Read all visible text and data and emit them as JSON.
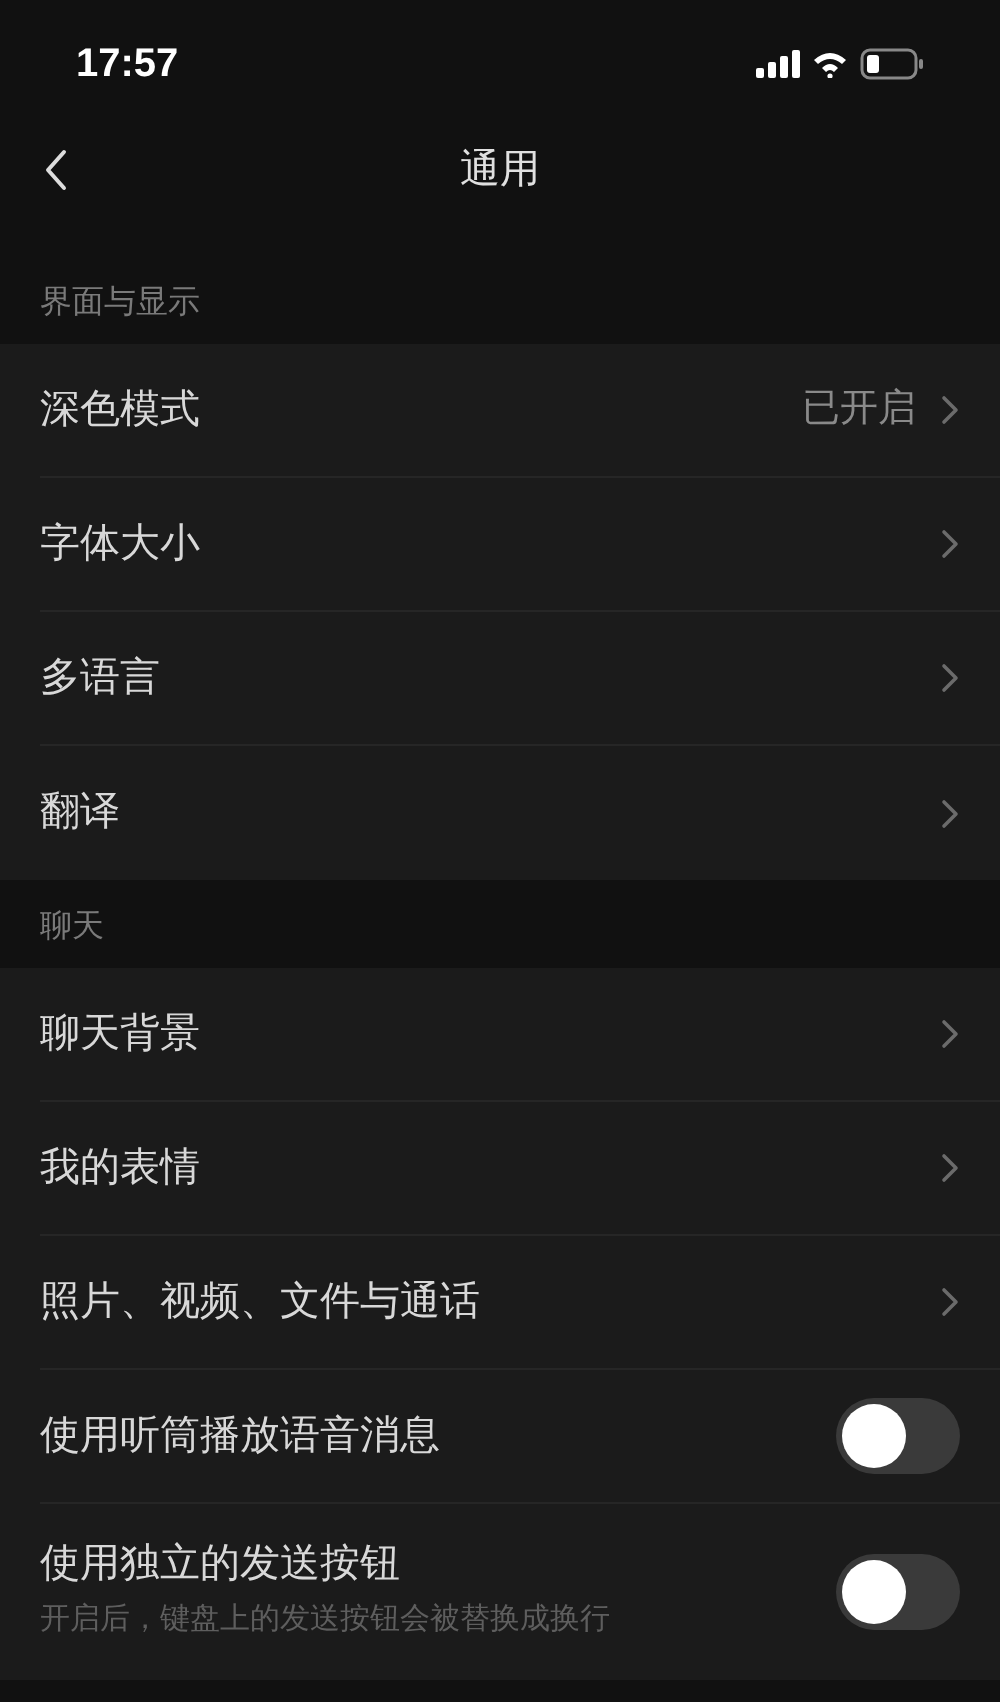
{
  "status_bar": {
    "time": "17:57"
  },
  "nav": {
    "title": "通用"
  },
  "sections": [
    {
      "header": "界面与显示",
      "items": [
        {
          "kind": "link",
          "label": "深色模式",
          "value": "已开启"
        },
        {
          "kind": "link",
          "label": "字体大小"
        },
        {
          "kind": "link",
          "label": "多语言"
        },
        {
          "kind": "link",
          "label": "翻译"
        }
      ]
    },
    {
      "header": "聊天",
      "items": [
        {
          "kind": "link",
          "label": "聊天背景"
        },
        {
          "kind": "link",
          "label": "我的表情"
        },
        {
          "kind": "link",
          "label": "照片、视频、文件与通话"
        },
        {
          "kind": "toggle",
          "label": "使用听筒播放语音消息",
          "on": false
        },
        {
          "kind": "toggle",
          "label": "使用独立的发送按钮",
          "description": "开启后，键盘上的发送按钮会被替换成换行",
          "on": false
        }
      ]
    }
  ]
}
